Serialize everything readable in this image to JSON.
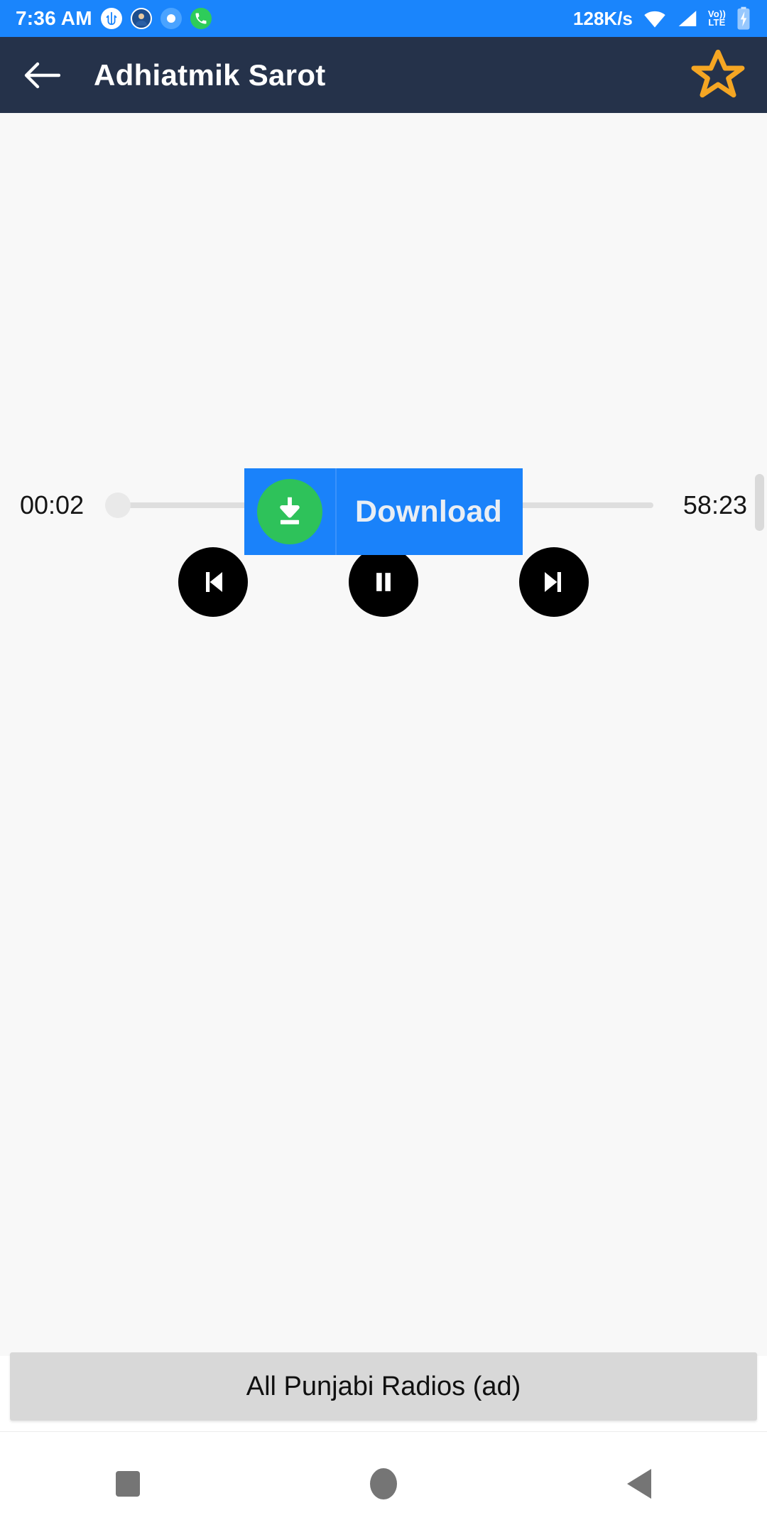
{
  "status_bar": {
    "clock": "7:36 AM",
    "network_speed": "128K/s",
    "volte_top": "Vo))",
    "volte_bottom": "LTE",
    "background_color": "#1a85fc",
    "notification_icons": [
      "trident-app-icon",
      "profile-avatar-icon",
      "location-app-icon",
      "whatsapp-call-icon"
    ],
    "right_icons": [
      "wifi-icon",
      "cellular-signal-icon",
      "volte-icon",
      "battery-charging-icon"
    ]
  },
  "app_bar": {
    "title": "Adhiatmik Sarot",
    "back_icon": "arrow-left-icon",
    "favorite_icon": "star-outline-icon",
    "favorite_color": "#f5a623",
    "background_color": "#25324a"
  },
  "player": {
    "current_time": "00:02",
    "total_time": "58:23",
    "progress_percent": 0,
    "controls": [
      {
        "name": "skip-previous-button",
        "icon": "skip-previous-icon"
      },
      {
        "name": "pause-button",
        "icon": "pause-icon"
      },
      {
        "name": "skip-next-button",
        "icon": "skip-next-icon"
      }
    ]
  },
  "download": {
    "label": "Download",
    "icon": "download-arrow-icon",
    "background_color": "#1a82fa",
    "icon_background_color": "#2ec25a"
  },
  "ad": {
    "label": "All Punjabi Radios (ad)"
  },
  "nav_bar": {
    "recents_icon": "square-recents-icon",
    "home_icon": "circle-home-icon",
    "back_icon": "triangle-back-icon"
  }
}
